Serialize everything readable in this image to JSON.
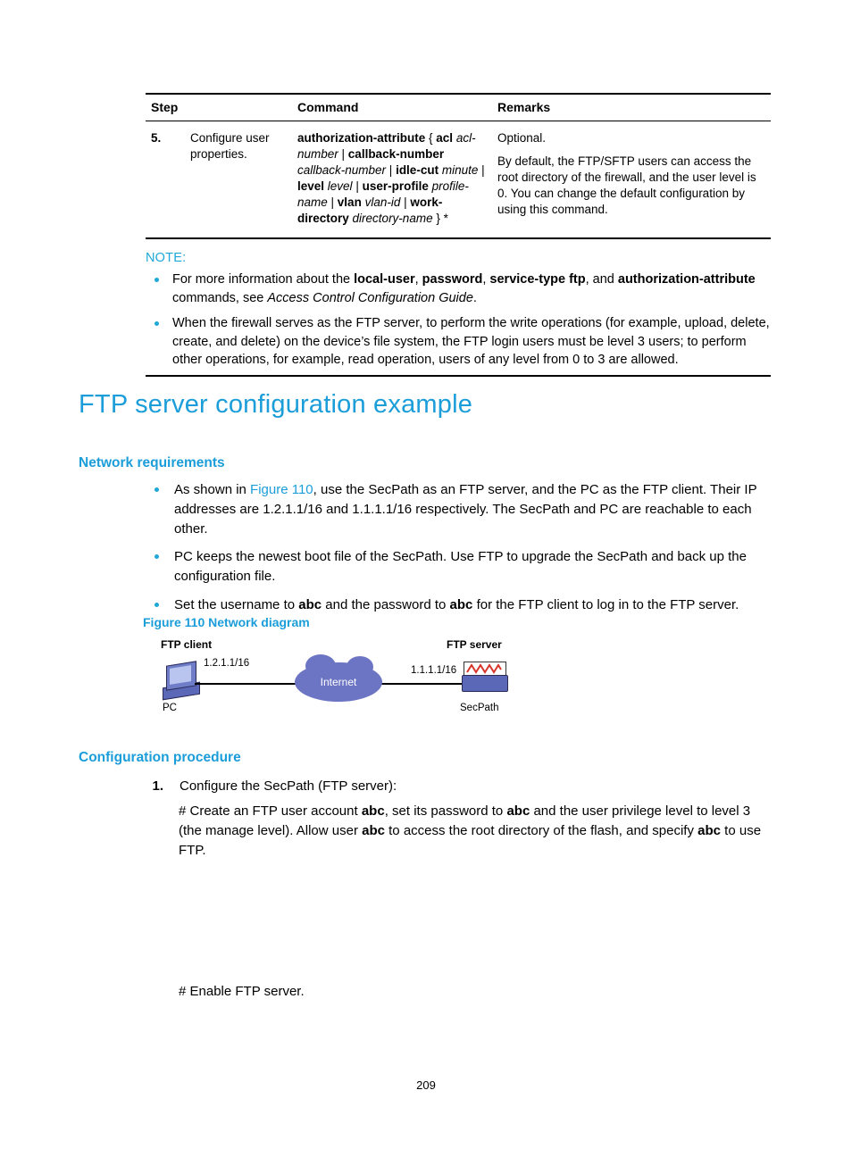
{
  "table": {
    "headers": [
      "Step",
      "Command",
      "Remarks"
    ],
    "rows": [
      {
        "num": "5.",
        "step": "Configure user properties.",
        "command_parts": [
          {
            "t": "authorization-attribute",
            "s": "bold"
          },
          {
            "t": " { ",
            "s": "normal"
          },
          {
            "t": "acl",
            "s": "bold"
          },
          {
            "t": " ",
            "s": "normal"
          },
          {
            "t": "acl-number",
            "s": "italic"
          },
          {
            "t": " | ",
            "s": "normal"
          },
          {
            "t": "callback-number",
            "s": "bold"
          },
          {
            "t": " ",
            "s": "normal"
          },
          {
            "t": "callback-number",
            "s": "italic"
          },
          {
            "t": " | ",
            "s": "normal"
          },
          {
            "t": "idle-cut",
            "s": "bold"
          },
          {
            "t": " ",
            "s": "normal"
          },
          {
            "t": "minute",
            "s": "italic"
          },
          {
            "t": " | ",
            "s": "normal"
          },
          {
            "t": "level",
            "s": "bold"
          },
          {
            "t": " ",
            "s": "normal"
          },
          {
            "t": "level",
            "s": "italic"
          },
          {
            "t": " | ",
            "s": "normal"
          },
          {
            "t": "user-profile",
            "s": "bold"
          },
          {
            "t": " ",
            "s": "normal"
          },
          {
            "t": "profile-name",
            "s": "italic"
          },
          {
            "t": " | ",
            "s": "normal"
          },
          {
            "t": "vlan",
            "s": "bold"
          },
          {
            "t": " ",
            "s": "normal"
          },
          {
            "t": "vlan-id",
            "s": "italic"
          },
          {
            "t": " | ",
            "s": "normal"
          },
          {
            "t": "work-directory",
            "s": "bold"
          },
          {
            "t": " ",
            "s": "normal"
          },
          {
            "t": "directory-name",
            "s": "italic"
          },
          {
            "t": " } *",
            "s": "normal"
          }
        ],
        "remarks": "Optional.\nBy default, the FTP/SFTP users can access the root directory of the firewall, and the user level is 0. You can change the default configuration by using this command."
      }
    ]
  },
  "note": {
    "title": "NOTE:",
    "items": [
      {
        "parts": [
          {
            "t": "For more information about the ",
            "s": "normal"
          },
          {
            "t": "local-user",
            "s": "bold"
          },
          {
            "t": ", ",
            "s": "normal"
          },
          {
            "t": "password",
            "s": "bold"
          },
          {
            "t": ", ",
            "s": "normal"
          },
          {
            "t": "service-type ftp",
            "s": "bold"
          },
          {
            "t": ", and ",
            "s": "normal"
          },
          {
            "t": "authorization-attribute",
            "s": "bold"
          },
          {
            "t": " commands, see ",
            "s": "normal"
          },
          {
            "t": "Access Control Configuration Guide",
            "s": "italic"
          },
          {
            "t": ".",
            "s": "normal"
          }
        ]
      },
      {
        "parts": [
          {
            "t": "When the firewall serves as the FTP server, to perform the write operations (for example, upload, delete, create, and delete) on the device’s file system, the FTP login users must be level 3 users; to perform other operations, for example, read operation, users of any level from 0 to 3 are allowed.",
            "s": "normal"
          }
        ]
      }
    ]
  },
  "headings": {
    "h1": "FTP server configuration example",
    "network_requirements": "Network requirements",
    "configuration_procedure": "Configuration procedure"
  },
  "requirements": [
    {
      "parts": [
        {
          "t": "As shown in ",
          "s": "normal"
        },
        {
          "t": "Figure 110",
          "s": "link"
        },
        {
          "t": ", use the SecPath as an FTP server, and the PC as the FTP client. Their IP addresses are 1.2.1.1/16 and 1.1.1.1/16 respectively. The SecPath and PC are reachable to each other.",
          "s": "normal"
        }
      ]
    },
    {
      "parts": [
        {
          "t": "PC keeps the newest boot file of the SecPath. Use FTP to upgrade the SecPath and back up the configuration file.",
          "s": "normal"
        }
      ]
    },
    {
      "parts": [
        {
          "t": "Set the username to ",
          "s": "normal"
        },
        {
          "t": "abc",
          "s": "bold"
        },
        {
          "t": " and the password to ",
          "s": "normal"
        },
        {
          "t": "abc",
          "s": "bold"
        },
        {
          "t": " for the FTP client to log in to the FTP server.",
          "s": "normal"
        }
      ]
    }
  ],
  "figure": {
    "caption": "Figure 110 Network diagram",
    "ftp_client_label": "FTP client",
    "ftp_server_label": "FTP server",
    "pc_label": "PC",
    "secpath_label": "SecPath",
    "client_ip": "1.2.1.1/16",
    "server_ip": "1.1.1.1/16",
    "cloud_label": "Internet"
  },
  "procedure": {
    "step1_num": "1.",
    "step1_text": "Configure the SecPath (FTP server):",
    "para1_parts": [
      {
        "t": "# Create an FTP user account ",
        "s": "normal"
      },
      {
        "t": "abc",
        "s": "bold"
      },
      {
        "t": ", set its password to ",
        "s": "normal"
      },
      {
        "t": "abc",
        "s": "bold"
      },
      {
        "t": " and the user privilege level to level 3 (the manage level). Allow user ",
        "s": "normal"
      },
      {
        "t": "abc",
        "s": "bold"
      },
      {
        "t": " to access the root directory of the flash, and specify ",
        "s": "normal"
      },
      {
        "t": "abc",
        "s": "bold"
      },
      {
        "t": " to use FTP.",
        "s": "normal"
      }
    ],
    "para2": "# Enable FTP server."
  },
  "page_number": "209",
  "colors": {
    "heading_blue": "#1b9dd9",
    "bullet_blue": "#1da8d8",
    "cloud_purple": "#6c74c4"
  }
}
